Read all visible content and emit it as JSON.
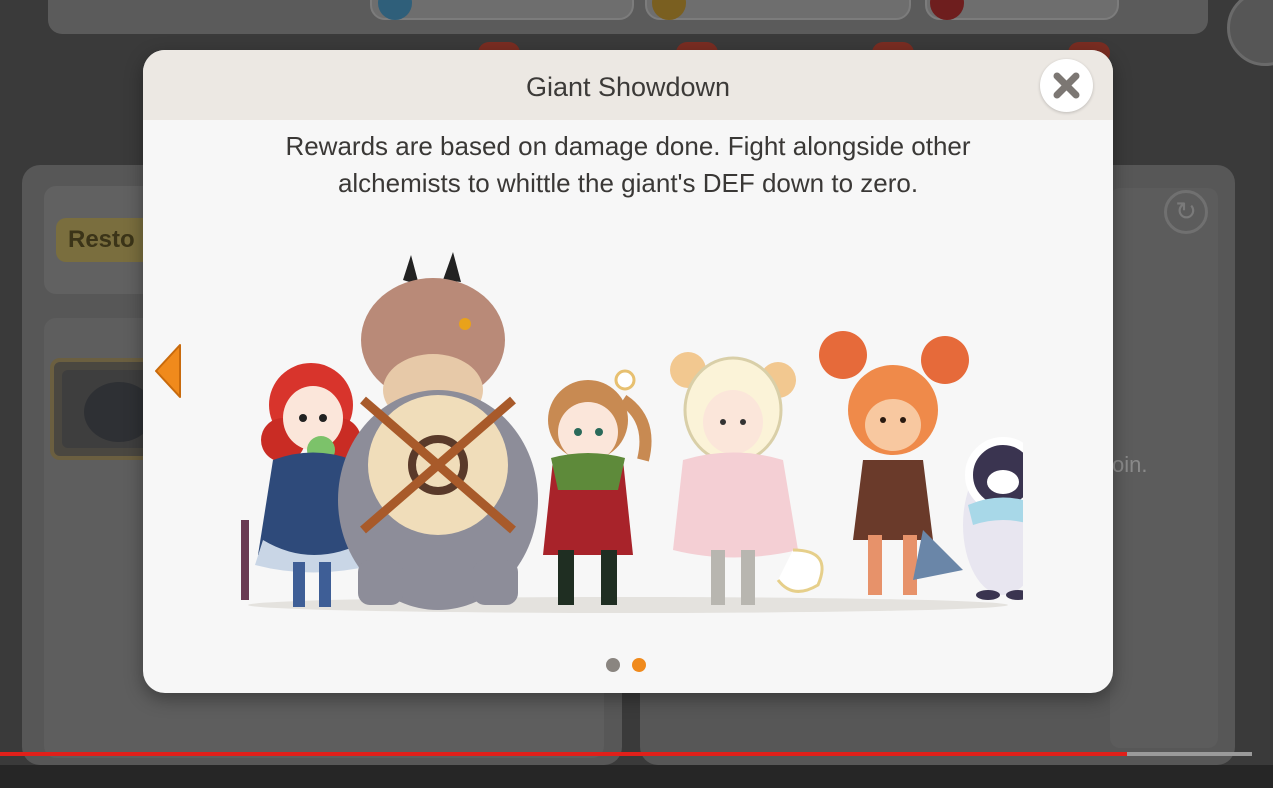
{
  "background": {
    "restore_button_label": "Resto",
    "partial_text": "oin.",
    "refresh_icon": "refresh-icon"
  },
  "modal": {
    "title": "Giant Showdown",
    "description_line1": "Rewards are based on damage done. Fight alongside other",
    "description_line2": "alchemists to whittle the giant's DEF down to zero.",
    "close_icon": "close-icon",
    "prev_arrow_icon": "arrow-left-icon",
    "pagination": {
      "total_pages": 2,
      "current_page": 2
    },
    "colors": {
      "accent_orange": "#f08a1c",
      "dot_inactive": "#8a8580",
      "dot_active": "#f08a1c",
      "header_bg": "#ece8e3"
    },
    "illustration_characters": [
      "red-haired-girl-with-frog",
      "giant-beast",
      "archer-girl",
      "hooded-girl-pink-cloak",
      "fox-eared-warrior",
      "penguin"
    ]
  },
  "video": {
    "progress": 0.9
  }
}
